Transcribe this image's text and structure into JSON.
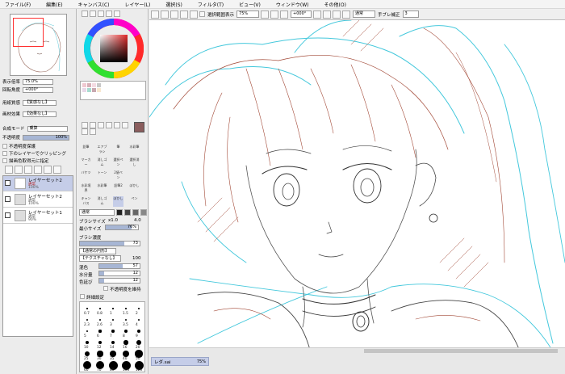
{
  "menu": [
    "ファイル(F)",
    "編集(E)",
    "キャンバス(C)",
    "レイヤー(L)",
    "選択(S)",
    "フィルタ(T)",
    "ビュー(V)",
    "ウィンドウ(W)",
    "その他(O)"
  ],
  "navigator": {
    "zoom_label": "表示倍率",
    "zoom_value": "75.0%",
    "angle_label": "回転角度",
    "angle_value": "+000°"
  },
  "paper": {
    "texture_label": "用紙質感",
    "texture_value": "【質感なし】",
    "effect_label": "画材効果",
    "effect_value": "【効果なし】",
    "blend_label": "合成モード",
    "blend_value": "乗算",
    "opacity_label": "不透明度",
    "opacity_value": "100%",
    "protect_label": "不透明度保護",
    "clip_label": "下のレイヤーでクリッピング",
    "ref_label": "描画色取得元に指定"
  },
  "layers": [
    {
      "name": "レイヤーセット2",
      "mode": "通常",
      "opacity": "100%",
      "selected": true
    },
    {
      "name": "レイヤーセット2",
      "mode": "通常",
      "opacity": "100%",
      "selected": false
    },
    {
      "name": "レイヤーセット1",
      "mode": "通常",
      "opacity": "90%",
      "selected": false
    }
  ],
  "tools": {
    "row1": [
      "鉛筆",
      "エアブラシ",
      "筆",
      "水彩筆"
    ],
    "row2": [
      "マーカー",
      "消しゴム",
      "選択ペン",
      "選択消し"
    ],
    "row3": [
      "バケツ",
      "トーン",
      "2値ペン",
      ""
    ],
    "row4": [
      "水彩境界",
      "水彩筆",
      "鉛筆2",
      "ぼかし"
    ],
    "row5": [
      "キャンバス",
      "消しゴム",
      "ぼかし",
      "ペン"
    ]
  },
  "brush": {
    "mode": "通常",
    "size_label": "ブラシサイズ",
    "size_mult": "x1.0",
    "size_value": "4.0",
    "min_label": "最小サイズ",
    "min_value": "76%",
    "density_label": "ブラシ濃度",
    "density_value": "73",
    "shape_label": "【通常の円形】",
    "tex_label": "【テクスチャなし】",
    "tex_value": "100",
    "blend_label": "混色",
    "blend_value": "57",
    "water_label": "水分量",
    "water_value": "12",
    "extend_label": "色延び",
    "extend_value": "12",
    "keep_label": "不透明度を維持",
    "detail_label": "詳細設定"
  },
  "sizes": [
    [
      "0.7",
      "0.8",
      "1",
      "1.5",
      "2"
    ],
    [
      "2.3",
      "2.6",
      "3",
      "3.5",
      "4"
    ],
    [
      "5",
      "6",
      "7",
      "8",
      "9"
    ],
    [
      "10",
      "12",
      "14",
      "16",
      "20"
    ],
    [
      "25",
      "30",
      "35",
      "40",
      "50"
    ],
    [
      "60",
      "70",
      "80",
      "100",
      "120"
    ]
  ],
  "topbar": {
    "show_sel": "選択範囲表示",
    "zoom": "75%",
    "angle": "+000°",
    "mode": "通常",
    "stab_label": "手ブレ補正",
    "stab_value": "3"
  },
  "statusbar": {
    "file": "レダ.sai",
    "zoom": "75%"
  },
  "colors": {
    "main": "#8a5d5d",
    "accent": "#a7b6d4",
    "sketch_red": "#a34a38",
    "sketch_cyan": "#44c8dc"
  }
}
